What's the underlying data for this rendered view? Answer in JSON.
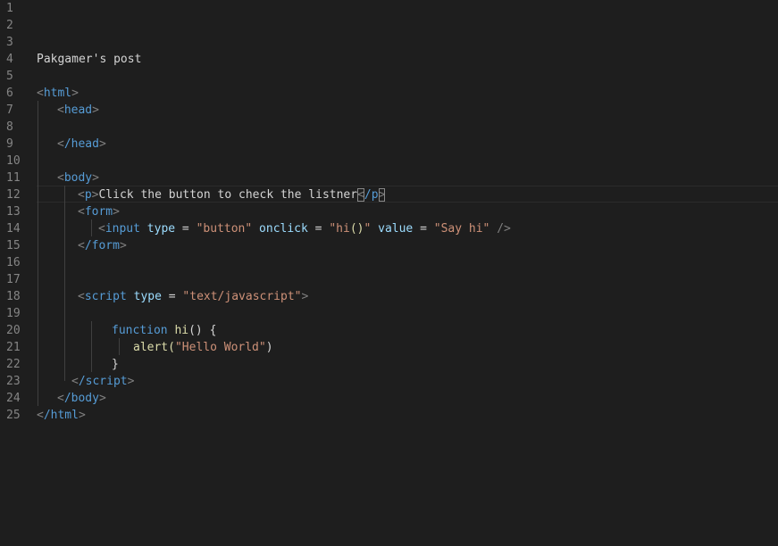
{
  "editor": {
    "line_numbers": [
      "1",
      "2",
      "3",
      "4",
      "5",
      "6",
      "7",
      "8",
      "9",
      "10",
      "11",
      "12",
      "13",
      "14",
      "15",
      "16",
      "17",
      "18",
      "19",
      "20",
      "21",
      "22",
      "23",
      "24",
      "25"
    ],
    "post_title": "Pakgamer's post",
    "code": {
      "html_open": "html",
      "head_open": "head",
      "head_close": "/head",
      "body_open": "body",
      "p_open": "p",
      "p_text": "Click the button to check the listner",
      "p_close": "/p",
      "form_open": "form",
      "input_tag": "input",
      "attr_type": "type",
      "eq": " = ",
      "val_button": "\"button\"",
      "attr_onclick": "onclick",
      "val_onclick_open": "\"hi",
      "val_onclick_parens": "()",
      "val_onclick_close": "\"",
      "attr_value": "value",
      "val_sayhi": "\"Say hi\"",
      "self_close": "/>",
      "form_close": "/form",
      "script_open": "script",
      "val_script_type": "\"text/javascript\"",
      "kw_function": "function",
      "fn_name": "hi",
      "fn_sig_rest": "() {",
      "alert_call": "alert(",
      "alert_str": "\"Hello World\"",
      "alert_close": ")",
      "brace_close": "}",
      "script_close": "/script",
      "body_close": "/body",
      "html_close": "/html"
    }
  },
  "colors": {
    "background": "#1e1e1e",
    "line_number": "#858585",
    "tag": "#569cd6",
    "attribute": "#9cdcfe",
    "string": "#ce9178",
    "punctuation": "#808080",
    "text": "#d4d4d4",
    "function": "#dcdcaa"
  }
}
